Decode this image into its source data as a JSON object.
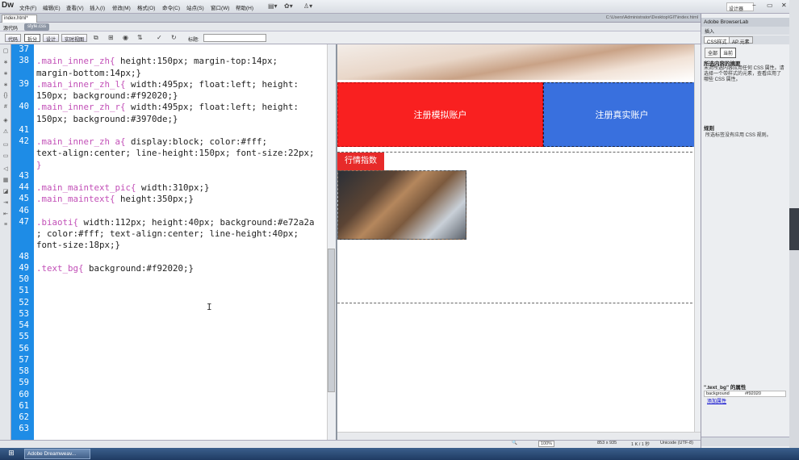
{
  "app": {
    "logo": "Dw",
    "workspace": "设计器",
    "search_icon": "search-icon"
  },
  "menu": [
    "文件(F)",
    "编辑(E)",
    "查看(V)",
    "插入(I)",
    "修改(M)",
    "格式(O)",
    "命令(C)",
    "站点(S)",
    "窗口(W)",
    "帮助(H)"
  ],
  "document": {
    "tab": "index.html*",
    "path": "C:\\Users\\Administrator\\Desktop\\GIT\\index.html",
    "related_source": "源代码",
    "related_css": "style.css"
  },
  "view_buttons": [
    "代码",
    "拆分",
    "设计",
    "实时视图"
  ],
  "title_label": "标题:",
  "code": {
    "line_numbers": [
      "37",
      "38",
      "39",
      "40",
      "41",
      "42",
      "43",
      "44",
      "45",
      "46",
      "47",
      "48",
      "49",
      "50",
      "51",
      "52",
      "53",
      "54",
      "55",
      "56",
      "57",
      "58",
      "59",
      "60",
      "61",
      "62",
      "63"
    ],
    "lines": [
      {
        "sel": "",
        "body": ""
      },
      {
        "sel": ".main_inner_zh{",
        "body": " height:150px; margin-top:14px;"
      },
      {
        "sel": "",
        "body": "margin-bottom:14px;}"
      },
      {
        "sel": ".main_inner_zh_l{",
        "body": " width:495px; float:left; height:"
      },
      {
        "sel": "",
        "body": "150px; background:#f92020;}"
      },
      {
        "sel": ".main_inner_zh_r{",
        "body": " width:495px; float:left; height:"
      },
      {
        "sel": "",
        "body": "150px; background:#3970de;}"
      },
      {
        "sel": "",
        "body": ""
      },
      {
        "sel": ".main_inner_zh a{",
        "body": " display:block; color:#fff;"
      },
      {
        "sel": "",
        "body": "text-align:center; line-height:150px; font-size:22px;"
      },
      {
        "sel": "",
        "body": "}"
      },
      {
        "sel": "",
        "body": ""
      },
      {
        "sel": ".main_maintext_pic{",
        "body": " width:310px;}"
      },
      {
        "sel": ".main_maintext{",
        "body": " height:350px;}"
      },
      {
        "sel": "",
        "body": ""
      },
      {
        "sel": ".biaoti{",
        "body": " width:112px; height:40px; background:#e72a2a"
      },
      {
        "sel": "",
        "body": "; color:#fff; text-align:center; line-height:40px;"
      },
      {
        "sel": "",
        "body": "font-size:18px;}"
      },
      {
        "sel": "",
        "body": ""
      },
      {
        "sel": ".text_bg{",
        "body": " background:#f92020;}"
      }
    ]
  },
  "design": {
    "btn_mock": "注册模拟账户",
    "btn_real": "注册真实账户",
    "biaoti": "行情指数"
  },
  "status": {
    "zoom": "100%",
    "size": "853 x 935",
    "kb": "1 K / 1 秒",
    "encoding": "Unicode (UTF-8)"
  },
  "panel": {
    "header": "Adobe BrowserLab",
    "insert": "插入",
    "tabs": [
      "CSS样式",
      "AP 元素"
    ],
    "modes": [
      "全部",
      "当前"
    ],
    "summary_title": "所选内容的摘要",
    "summary_text": "未对所选内容应用任何 CSS 属性。请选择一个带样式的元素，查看应用了哪些 CSS 属性。",
    "rules_title": "规则",
    "rules_text": "所选标签没有应用 CSS 规则。",
    "props_title": "\".text_bg\" 的属性",
    "prop_name": "background",
    "prop_value": "#f92020",
    "add_prop": "添加属性"
  },
  "taskbar": {
    "item": "Adobe Dreamweav..."
  },
  "colors": {
    "gutter": "#1e8ce6",
    "selector": "#c24fb7",
    "red": "#f92020",
    "blue": "#3970de",
    "title_red": "#e72a2a"
  }
}
